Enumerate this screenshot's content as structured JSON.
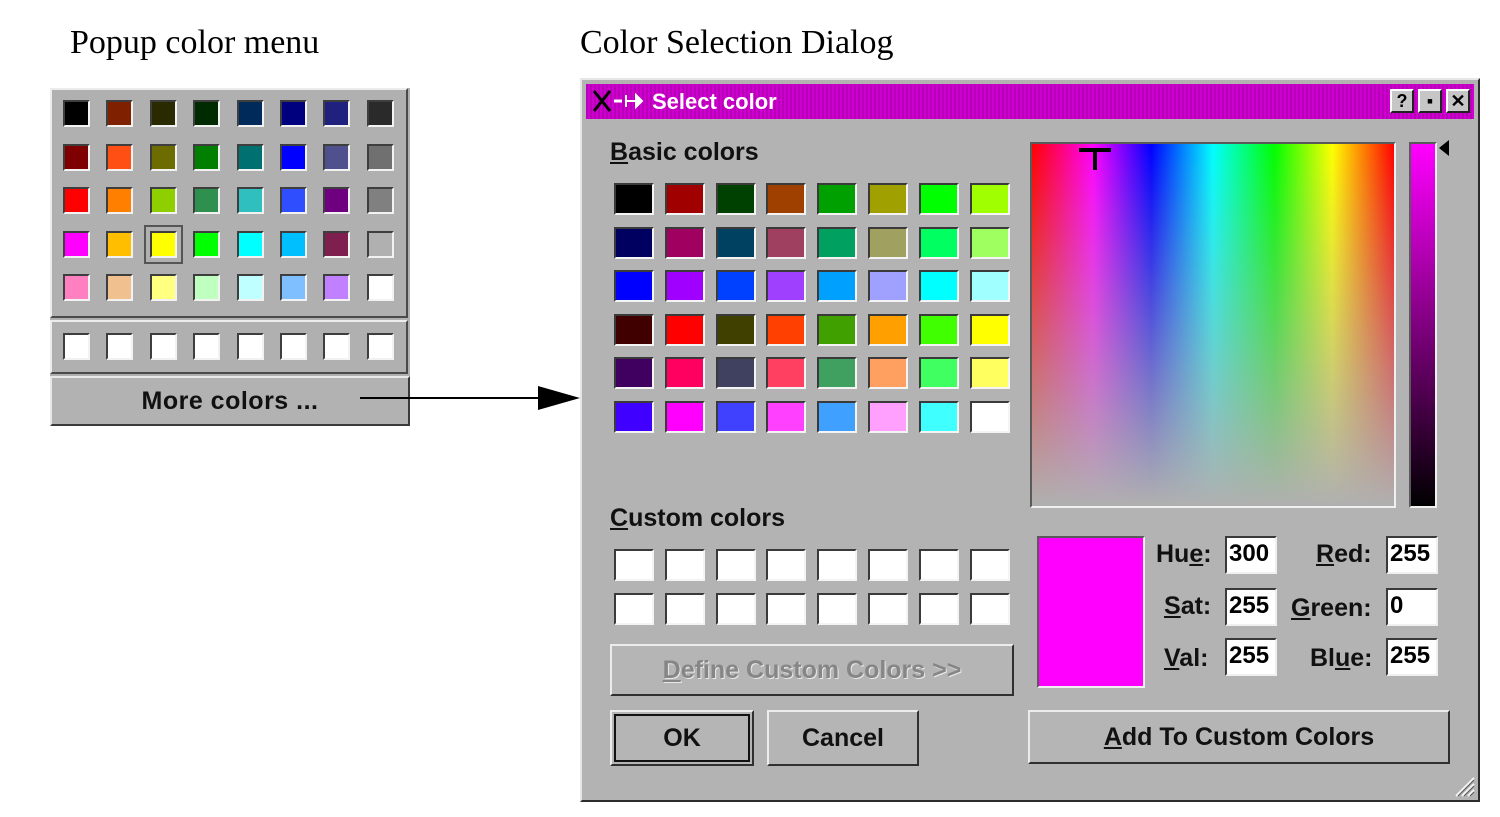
{
  "captions": {
    "popup": "Popup color menu",
    "dialog": "Color Selection Dialog"
  },
  "popup": {
    "colors": [
      [
        "#000000",
        "#7f2000",
        "#2a2a00",
        "#002a00",
        "#002a5a",
        "#00007f",
        "#20207f",
        "#2a2a2a"
      ],
      [
        "#7f0000",
        "#ff4f14",
        "#6c6c00",
        "#007f00",
        "#007070",
        "#0000ff",
        "#50508f",
        "#707070"
      ],
      [
        "#ff0000",
        "#ff7f00",
        "#8fcf00",
        "#2f8f4f",
        "#2fbfbf",
        "#2f4fff",
        "#6f007f",
        "#808080"
      ],
      [
        "#ff00ff",
        "#ffbf00",
        "#ffff00",
        "#00ff00",
        "#00ffff",
        "#00bfff",
        "#7f1f4f",
        "#b0b0b0"
      ],
      [
        "#ff80c0",
        "#f0c08f",
        "#ffff80",
        "#bfffbf",
        "#bfffff",
        "#80bfff",
        "#c080ff",
        "#ffffff"
      ]
    ],
    "selected_row": 3,
    "selected_col": 2,
    "custom_row": [
      "#ffffff",
      "#ffffff",
      "#ffffff",
      "#ffffff",
      "#ffffff",
      "#ffffff",
      "#ffffff",
      "#ffffff"
    ],
    "more_label": "More colors ..."
  },
  "dialog": {
    "title": "Select color",
    "help_btn": "?",
    "max_btn": "▪",
    "close_btn": "✕",
    "basic_label_u": "B",
    "basic_label_rest": "asic colors",
    "basic_colors": [
      [
        "#000000",
        "#a00000",
        "#004000",
        "#a04000",
        "#00a000",
        "#a0a000",
        "#00ff00",
        "#a0ff00"
      ],
      [
        "#000060",
        "#a00060",
        "#004060",
        "#a04060",
        "#00a060",
        "#a0a060",
        "#00ff60",
        "#a0ff60"
      ],
      [
        "#0000ff",
        "#a000ff",
        "#0040ff",
        "#a040ff",
        "#00a0ff",
        "#a0a0ff",
        "#00ffff",
        "#a0ffff"
      ],
      [
        "#400000",
        "#ff0000",
        "#404000",
        "#ff4000",
        "#40a000",
        "#ffa000",
        "#40ff00",
        "#ffff00"
      ],
      [
        "#400060",
        "#ff0060",
        "#404060",
        "#ff4060",
        "#40a060",
        "#ffa060",
        "#40ff60",
        "#ffff60"
      ],
      [
        "#4000ff",
        "#ff00ff",
        "#4040ff",
        "#ff40ff",
        "#40a0ff",
        "#ffa0ff",
        "#40ffff",
        "#ffffff"
      ]
    ],
    "custom_label_u": "C",
    "custom_label_rest": "ustom colors",
    "custom_colors": [
      [
        "#ffffff",
        "#ffffff",
        "#ffffff",
        "#ffffff",
        "#ffffff",
        "#ffffff",
        "#ffffff",
        "#ffffff"
      ],
      [
        "#ffffff",
        "#ffffff",
        "#ffffff",
        "#ffffff",
        "#ffffff",
        "#ffffff",
        "#ffffff",
        "#ffffff"
      ]
    ],
    "define_u": "D",
    "define_rest": "efine Custom Colors >>",
    "ok_label": "OK",
    "cancel_label": "Cancel",
    "add_u": "A",
    "add_rest": "dd To Custom Colors",
    "preview_color": "#ff00ff",
    "hue": {
      "pre": "Hu",
      "u": "e",
      "post": ":",
      "value": "300"
    },
    "sat": {
      "pre": "",
      "u": "S",
      "post": "at:",
      "value": "255"
    },
    "val": {
      "pre": "",
      "u": "V",
      "post": "al:",
      "value": "255"
    },
    "red": {
      "pre": "",
      "u": "R",
      "post": "ed:",
      "value": "255"
    },
    "green": {
      "pre": "",
      "u": "G",
      "post": "reen:",
      "value": "0"
    },
    "blue": {
      "pre": "Bl",
      "u": "u",
      "post": "e:",
      "value": "255"
    }
  }
}
